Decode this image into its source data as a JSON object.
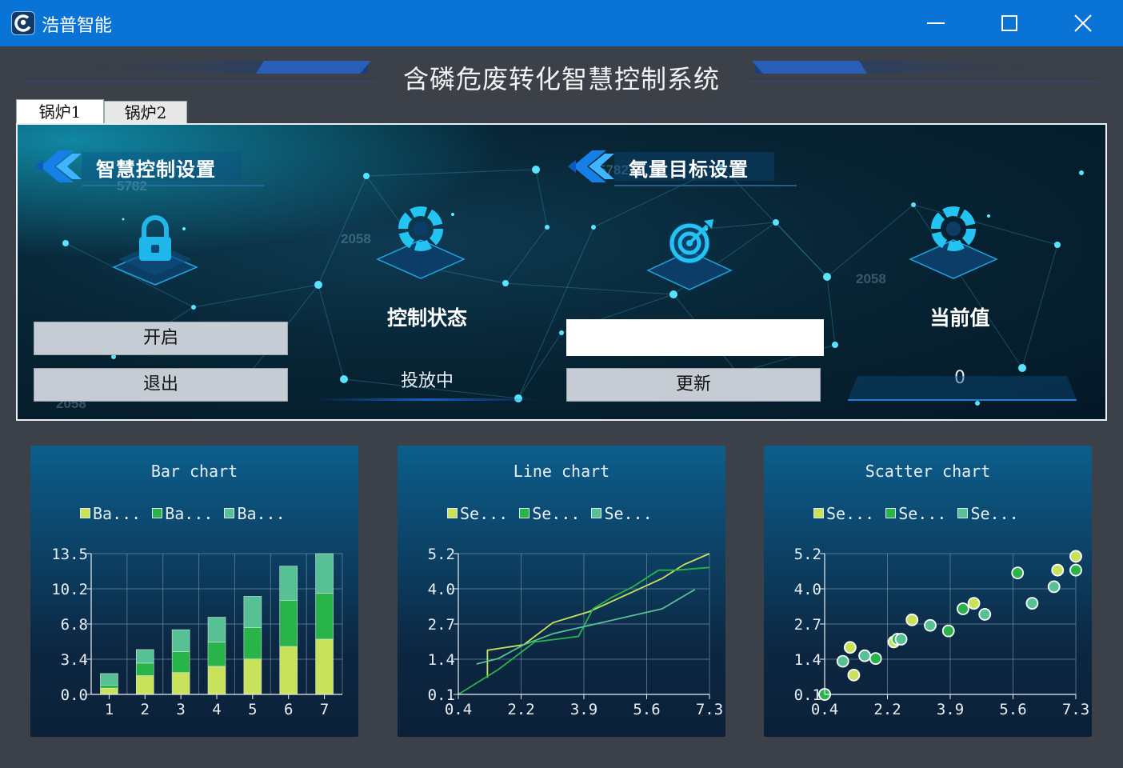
{
  "window": {
    "app_title": "浩普智能",
    "accent_color": "#0a74d6"
  },
  "header": {
    "title": "含磷危废转化智慧控制系统"
  },
  "tabs": [
    {
      "label": "锅炉1",
      "active": true
    },
    {
      "label": "锅炉2",
      "active": false
    }
  ],
  "panel": {
    "smart_control": {
      "title": "智慧控制设置",
      "start_button": "开启",
      "exit_button": "退出"
    },
    "control_status": {
      "label": "控制状态",
      "value": "投放中"
    },
    "oxygen_target": {
      "title": "氧量目标设置",
      "input_value": "",
      "update_button": "更新"
    },
    "current_value": {
      "label": "当前值",
      "value": "0"
    },
    "background_numbers": [
      "5782",
      "2058",
      "2058",
      "2058",
      "5782",
      "5782"
    ]
  },
  "chart_data": [
    {
      "type": "bar",
      "stacked": true,
      "title": "Bar chart",
      "legend": [
        "Ba...",
        "Ba...",
        "Ba..."
      ],
      "categories": [
        "1",
        "2",
        "3",
        "4",
        "5",
        "6",
        "7"
      ],
      "series": [
        {
          "values": [
            0.6,
            1.8,
            2.1,
            2.7,
            3.4,
            4.6,
            5.3
          ],
          "color": "#c8e35a"
        },
        {
          "values": [
            0.3,
            1.2,
            2.0,
            2.3,
            3.0,
            4.4,
            4.4
          ],
          "color": "#28b449"
        },
        {
          "values": [
            1.1,
            1.3,
            2.1,
            2.4,
            3.0,
            3.3,
            3.8
          ],
          "color": "#58c095"
        }
      ],
      "ylim": [
        0.0,
        13.5
      ],
      "yticks": [
        "0.0",
        "3.4",
        "6.8",
        "10.2",
        "13.5"
      ],
      "grid": true,
      "legend_position": "top"
    },
    {
      "type": "line",
      "title": "Line chart",
      "legend": [
        "Se...",
        "Se...",
        "Se..."
      ],
      "xlim": [
        0.4,
        7.3
      ],
      "ylim": [
        0.1,
        5.2
      ],
      "xticks": [
        "0.4",
        "2.2",
        "3.9",
        "5.6",
        "7.3"
      ],
      "yticks": [
        "0.1",
        "1.4",
        "2.7",
        "4.0",
        "5.2"
      ],
      "series": [
        {
          "color": "#c8e35a",
          "points": [
            [
              1.2,
              0.7
            ],
            [
              1.2,
              1.7
            ],
            [
              2.2,
              1.9
            ],
            [
              3.0,
              2.7
            ],
            [
              4.0,
              3.1
            ],
            [
              5.0,
              3.7
            ],
            [
              6.0,
              4.3
            ],
            [
              6.6,
              4.8
            ],
            [
              7.3,
              5.2
            ]
          ]
        },
        {
          "color": "#28b449",
          "points": [
            [
              0.4,
              0.1
            ],
            [
              1.5,
              1.0
            ],
            [
              2.5,
              2.0
            ],
            [
              3.1,
              2.1
            ],
            [
              3.7,
              2.2
            ],
            [
              4.1,
              3.2
            ],
            [
              4.6,
              3.6
            ],
            [
              5.2,
              4.0
            ],
            [
              5.9,
              4.6
            ],
            [
              6.4,
              4.6
            ],
            [
              7.3,
              4.7
            ]
          ]
        },
        {
          "color": "#58c095",
          "points": [
            [
              0.9,
              1.2
            ],
            [
              1.5,
              1.4
            ],
            [
              2.2,
              1.9
            ],
            [
              3.0,
              2.3
            ],
            [
              4.0,
              2.6
            ],
            [
              5.0,
              2.9
            ],
            [
              6.0,
              3.2
            ],
            [
              6.9,
              3.9
            ]
          ]
        }
      ],
      "grid": true,
      "legend_position": "top"
    },
    {
      "type": "scatter",
      "title": "Scatter chart",
      "legend": [
        "Se...",
        "Se...",
        "Se..."
      ],
      "xlim": [
        0.4,
        7.3
      ],
      "ylim": [
        0.1,
        5.2
      ],
      "xticks": [
        "0.4",
        "2.2",
        "3.9",
        "5.6",
        "7.3"
      ],
      "yticks": [
        "0.1",
        "1.4",
        "2.7",
        "4.0",
        "5.2"
      ],
      "series": [
        {
          "color": "#c8e35a",
          "points": [
            [
              0.4,
              0.1
            ],
            [
              1.1,
              1.8
            ],
            [
              1.2,
              0.8
            ],
            [
              2.3,
              2.0
            ],
            [
              2.8,
              2.8
            ],
            [
              4.5,
              3.4
            ],
            [
              6.8,
              4.6
            ],
            [
              7.3,
              5.1
            ]
          ]
        },
        {
          "color": "#28b449",
          "points": [
            [
              0.4,
              0.1
            ],
            [
              1.8,
              1.4
            ],
            [
              2.4,
              2.1
            ],
            [
              3.8,
              2.4
            ],
            [
              4.2,
              3.2
            ],
            [
              5.7,
              4.5
            ],
            [
              7.3,
              4.6
            ]
          ]
        },
        {
          "color": "#58c095",
          "points": [
            [
              0.9,
              1.3
            ],
            [
              1.5,
              1.5
            ],
            [
              2.5,
              2.1
            ],
            [
              3.3,
              2.6
            ],
            [
              4.8,
              3.0
            ],
            [
              6.1,
              3.4
            ],
            [
              6.7,
              4.0
            ]
          ]
        }
      ],
      "grid": true,
      "legend_position": "top"
    }
  ]
}
